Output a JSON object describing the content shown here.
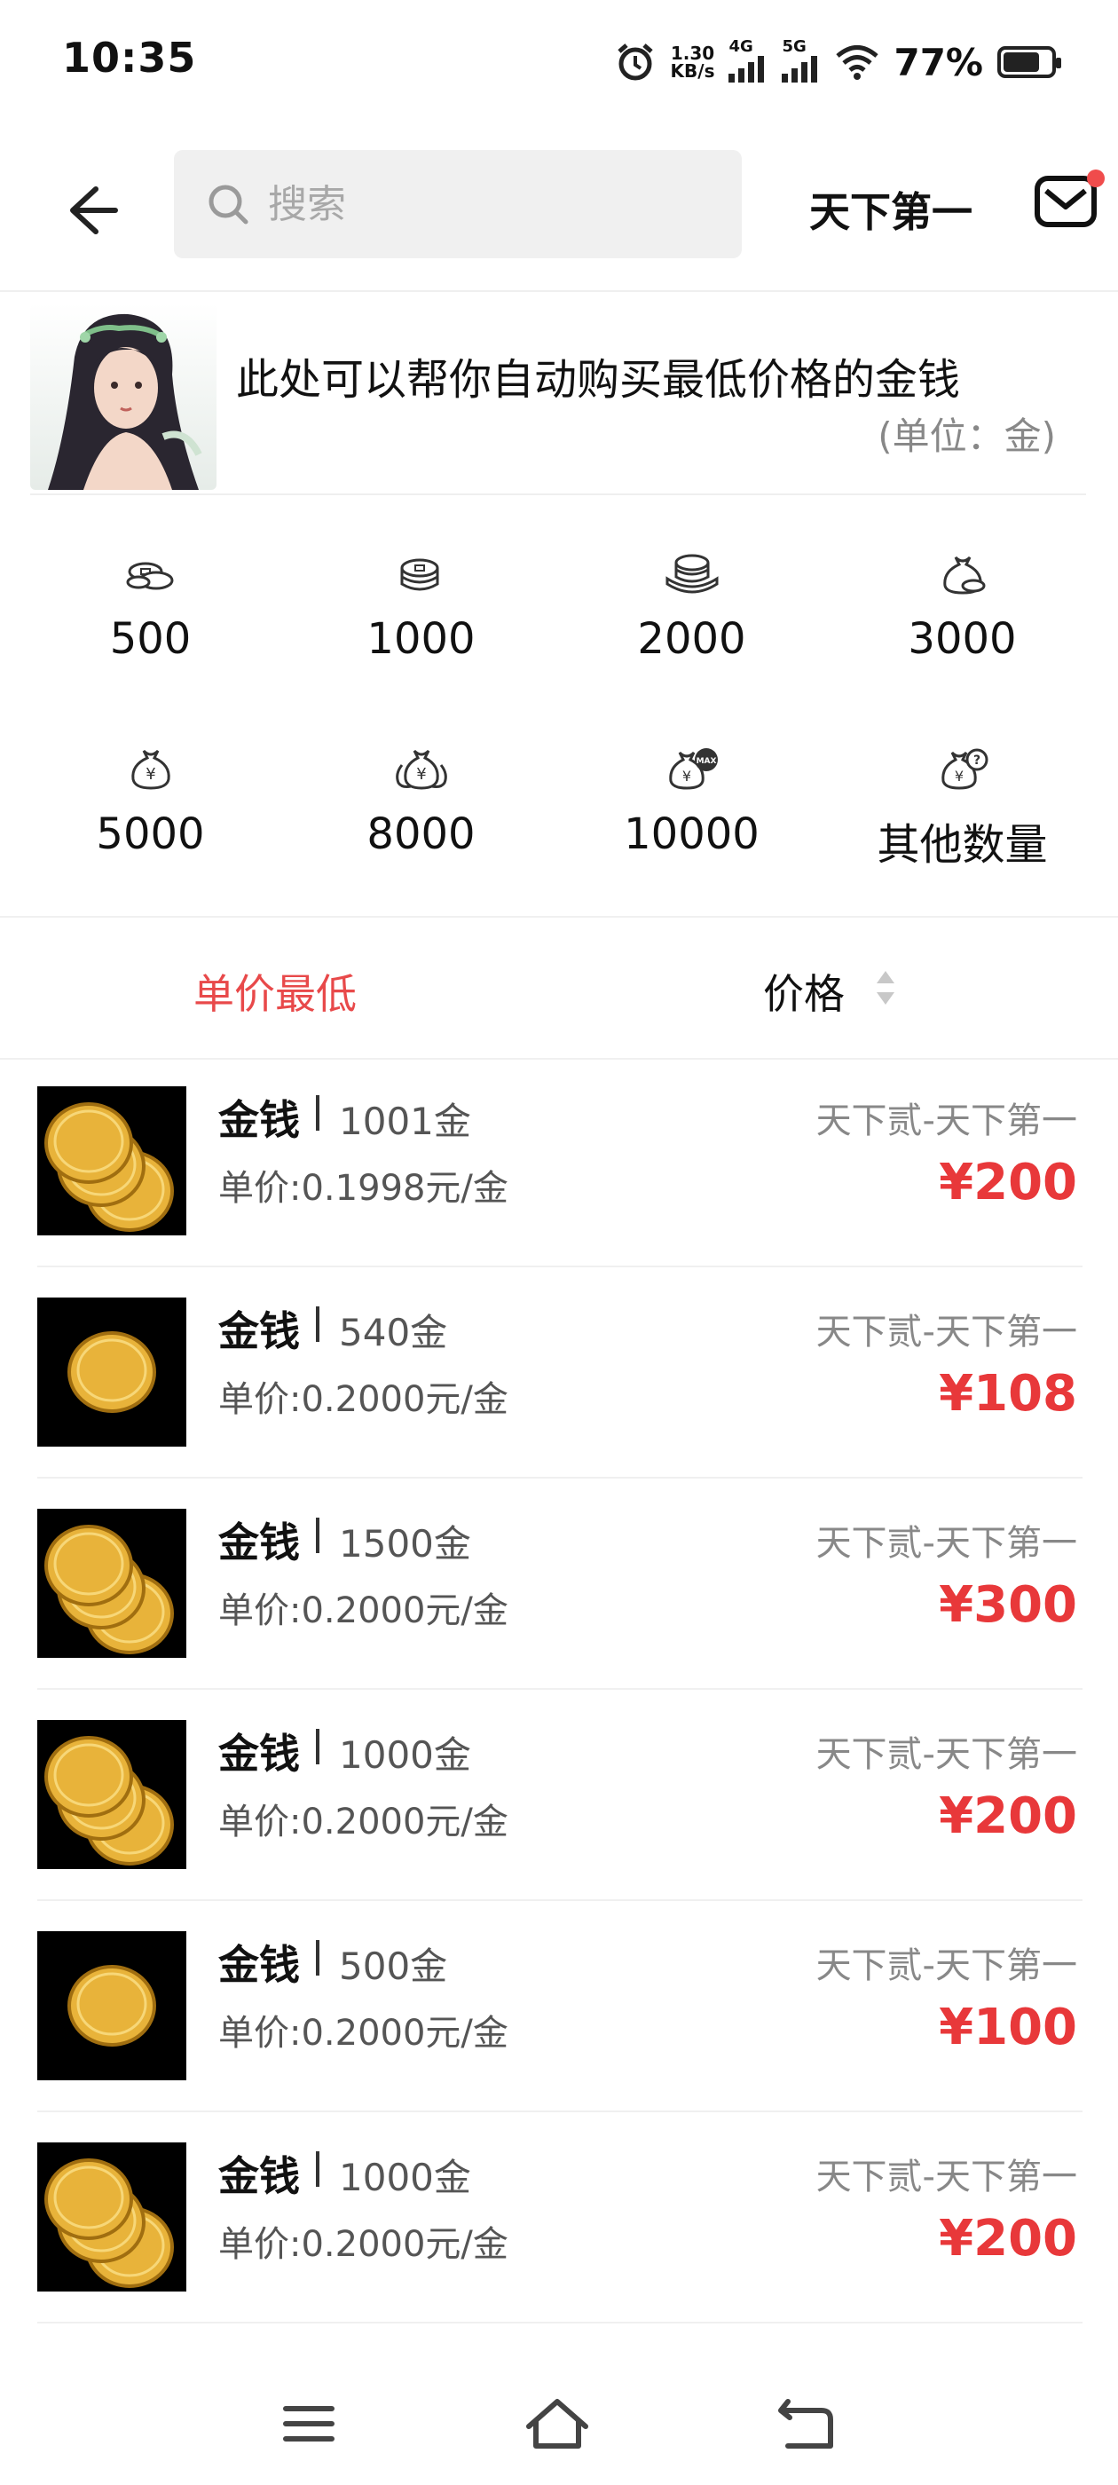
{
  "status": {
    "time": "10:35",
    "speed_value": "1.30",
    "speed_unit": "KB/s",
    "net1": "4G",
    "net2": "5G",
    "battery": "77%",
    "battery_level": 0.77
  },
  "header": {
    "search_placeholder": "搜索",
    "server": "天下第一"
  },
  "banner": {
    "title": "此处可以帮你自动购买最低价格的金钱",
    "unit": "(单位：金)"
  },
  "quantities": [
    {
      "label": "500",
      "icon": "coins-small-icon"
    },
    {
      "label": "1000",
      "icon": "coins-stack-icon"
    },
    {
      "label": "2000",
      "icon": "coins-pile-icon"
    },
    {
      "label": "3000",
      "icon": "money-bag-icon"
    },
    {
      "label": "5000",
      "icon": "yen-bag-icon"
    },
    {
      "label": "8000",
      "icon": "yen-bags-icon"
    },
    {
      "label": "10000",
      "icon": "max-bag-icon"
    },
    {
      "label": "其他数量",
      "icon": "question-bag-icon"
    }
  ],
  "sort": {
    "lowest_unit": "单价最低",
    "price": "价格"
  },
  "listings": [
    {
      "name": "金钱",
      "amount": "1001金",
      "unit_price": "单价:0.1998元/金",
      "server": "天下贰-天下第一",
      "price": "¥200",
      "coins": 3
    },
    {
      "name": "金钱",
      "amount": "540金",
      "unit_price": "单价:0.2000元/金",
      "server": "天下贰-天下第一",
      "price": "¥108",
      "coins": 1
    },
    {
      "name": "金钱",
      "amount": "1500金",
      "unit_price": "单价:0.2000元/金",
      "server": "天下贰-天下第一",
      "price": "¥300",
      "coins": 3
    },
    {
      "name": "金钱",
      "amount": "1000金",
      "unit_price": "单价:0.2000元/金",
      "server": "天下贰-天下第一",
      "price": "¥200",
      "coins": 3
    },
    {
      "name": "金钱",
      "amount": "500金",
      "unit_price": "单价:0.2000元/金",
      "server": "天下贰-天下第一",
      "price": "¥100",
      "coins": 1
    },
    {
      "name": "金钱",
      "amount": "1000金",
      "unit_price": "单价:0.2000元/金",
      "server": "天下贰-天下第一",
      "price": "¥200",
      "coins": 3
    }
  ],
  "colors": {
    "accent_red": "#e8383a",
    "gold": "#e8b33a"
  },
  "navbar": [
    "menu-icon",
    "home-icon",
    "back-icon"
  ]
}
